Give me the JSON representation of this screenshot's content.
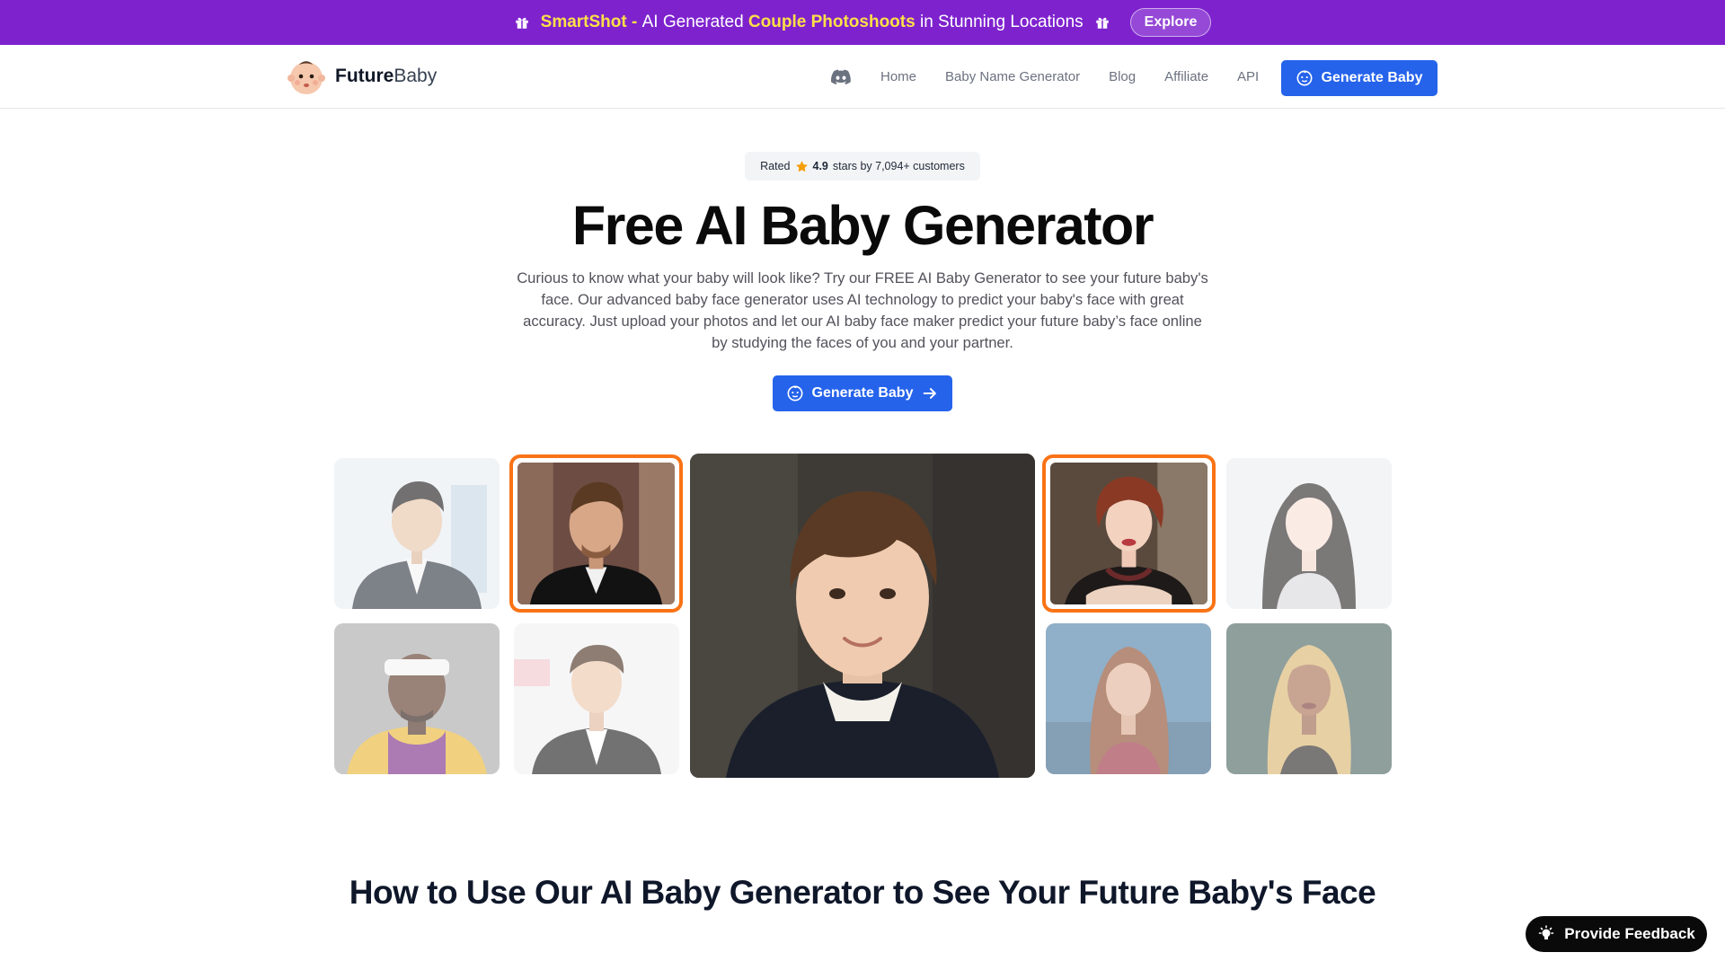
{
  "banner": {
    "brand": "SmartShot",
    "sep": " - ",
    "text_a": "AI Generated ",
    "highlight": "Couple Photoshoots",
    "text_b": " in Stunning Locations",
    "explore_label": "Explore",
    "icon": "gift-icon",
    "background": "#7e22ce",
    "highlight_color": "#fde047"
  },
  "nav": {
    "logo_bold": "Future",
    "logo_rest": "Baby",
    "links": [
      "Home",
      "Baby Name Generator",
      "Blog",
      "Affiliate",
      "API"
    ],
    "discord_icon": "discord-icon",
    "cta_label": "Generate Baby",
    "accent": "#2563eb"
  },
  "hero": {
    "rating_prefix": "Rated",
    "rating_value": "4.9",
    "rating_suffix": "stars by 7,094+ customers",
    "title": "Free AI Baby Generator",
    "description": "Curious to know what your baby will look like? Try our FREE AI Baby Generator to see your future baby's face. Our advanced baby face generator uses AI technology to predict your baby's face with great accuracy. Just upload your photos and let our AI baby face maker predict your future baby’s face online by studying the faces of you and your partner.",
    "cta_label": "Generate Baby"
  },
  "gallery": {
    "selected_border": "#f97316",
    "tiles": [
      {
        "name": "parent-photo-1",
        "selected": false
      },
      {
        "name": "parent-photo-2",
        "selected": true
      },
      {
        "name": "parent-photo-3",
        "selected": false
      },
      {
        "name": "parent-photo-4",
        "selected": false
      },
      {
        "name": "generated-baby-photo",
        "selected": false
      },
      {
        "name": "parent-photo-5",
        "selected": true
      },
      {
        "name": "parent-photo-6",
        "selected": false
      },
      {
        "name": "parent-photo-7",
        "selected": false
      },
      {
        "name": "parent-photo-8",
        "selected": false
      }
    ]
  },
  "section": {
    "how_title": "How to Use Our AI Baby Generator to See Your Future Baby's Face"
  },
  "feedback": {
    "label": "Provide Feedback"
  }
}
